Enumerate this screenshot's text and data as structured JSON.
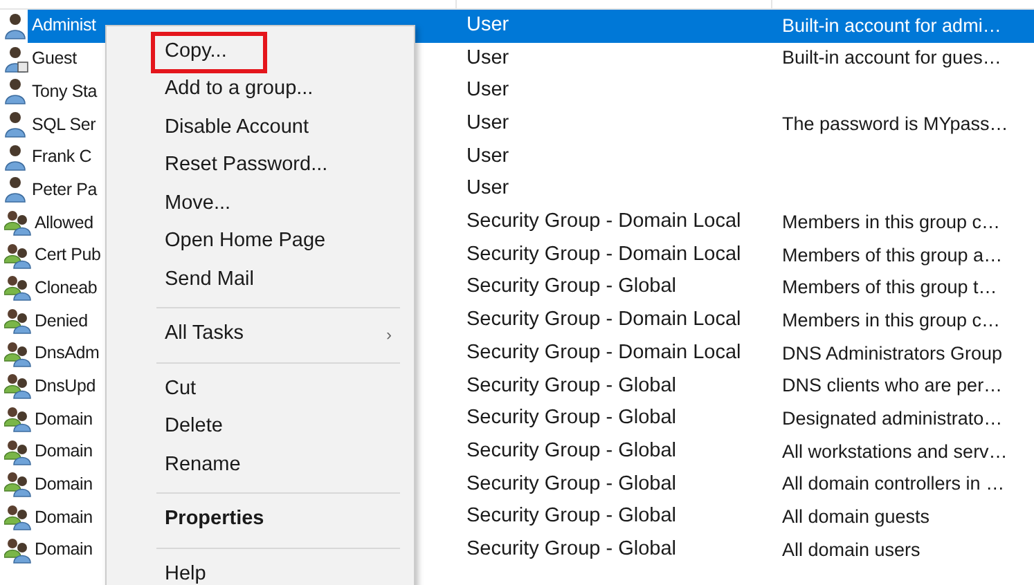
{
  "rows": [
    {
      "kind": "user",
      "name": "Administ",
      "type": "User",
      "description": "Built-in account for admi…",
      "selected": true
    },
    {
      "kind": "guest",
      "name": "Guest",
      "type": "User",
      "description": "Built-in account for gues…",
      "selected": false
    },
    {
      "kind": "user",
      "name": "Tony Sta",
      "type": "User",
      "selected": false
    },
    {
      "kind": "user",
      "name": "SQL Ser",
      "type": "User",
      "description": "The password is MYpass…",
      "selected": false
    },
    {
      "kind": "user",
      "name": "Frank C",
      "type": "User",
      "selected": false
    },
    {
      "kind": "user",
      "name": "Peter Pa",
      "type": "User",
      "selected": false
    },
    {
      "kind": "group",
      "name": "Allowed",
      "type": "Security Group - Domain Local",
      "description": "Members in this group c…",
      "selected": false
    },
    {
      "kind": "group",
      "name": "Cert Pub",
      "type": "Security Group - Domain Local",
      "description": "Members of this group a…",
      "selected": false
    },
    {
      "kind": "group",
      "name": "Cloneab",
      "type": "Security Group - Global",
      "description": "Members of this group t…",
      "selected": false
    },
    {
      "kind": "group",
      "name": "Denied",
      "type": "Security Group - Domain Local",
      "description": "Members in this group c…",
      "selected": false
    },
    {
      "kind": "group",
      "name": "DnsAdm",
      "type": "Security Group - Domain Local",
      "description": "DNS Administrators Group",
      "selected": false
    },
    {
      "kind": "group",
      "name": "DnsUpd",
      "type": "Security Group - Global",
      "description": "DNS clients who are per…",
      "selected": false
    },
    {
      "kind": "group",
      "name": "Domain",
      "type": "Security Group - Global",
      "description": "Designated administrato…",
      "selected": false
    },
    {
      "kind": "group",
      "name": "Domain",
      "type": "Security Group - Global",
      "description": "All workstations and serv…",
      "selected": false
    },
    {
      "kind": "group",
      "name": "Domain",
      "type": "Security Group - Global",
      "description": "All domain controllers in …",
      "selected": false
    },
    {
      "kind": "group",
      "name": "Domain",
      "type": "Security Group - Global",
      "description": "All domain guests",
      "selected": false
    },
    {
      "kind": "group",
      "name": "Domain",
      "type": "Security Group - Global",
      "description": "All domain users",
      "selected": false
    }
  ],
  "context_menu": [
    {
      "kind": "item",
      "label": "Copy...",
      "highlighted": true
    },
    {
      "kind": "item",
      "label": "Add to a group..."
    },
    {
      "kind": "item",
      "label": "Disable Account"
    },
    {
      "kind": "item",
      "label": "Reset Password..."
    },
    {
      "kind": "item",
      "label": "Move..."
    },
    {
      "kind": "item",
      "label": "Open Home Page"
    },
    {
      "kind": "item",
      "label": "Send Mail"
    },
    {
      "kind": "separator"
    },
    {
      "kind": "submenu",
      "label": "All Tasks",
      "arrow": "›"
    },
    {
      "kind": "separator"
    },
    {
      "kind": "item",
      "label": "Cut"
    },
    {
      "kind": "item",
      "label": "Delete"
    },
    {
      "kind": "item",
      "label": "Rename"
    },
    {
      "kind": "separator"
    },
    {
      "kind": "default",
      "label": "Properties"
    },
    {
      "kind": "separator"
    },
    {
      "kind": "item",
      "label": "Help"
    }
  ]
}
